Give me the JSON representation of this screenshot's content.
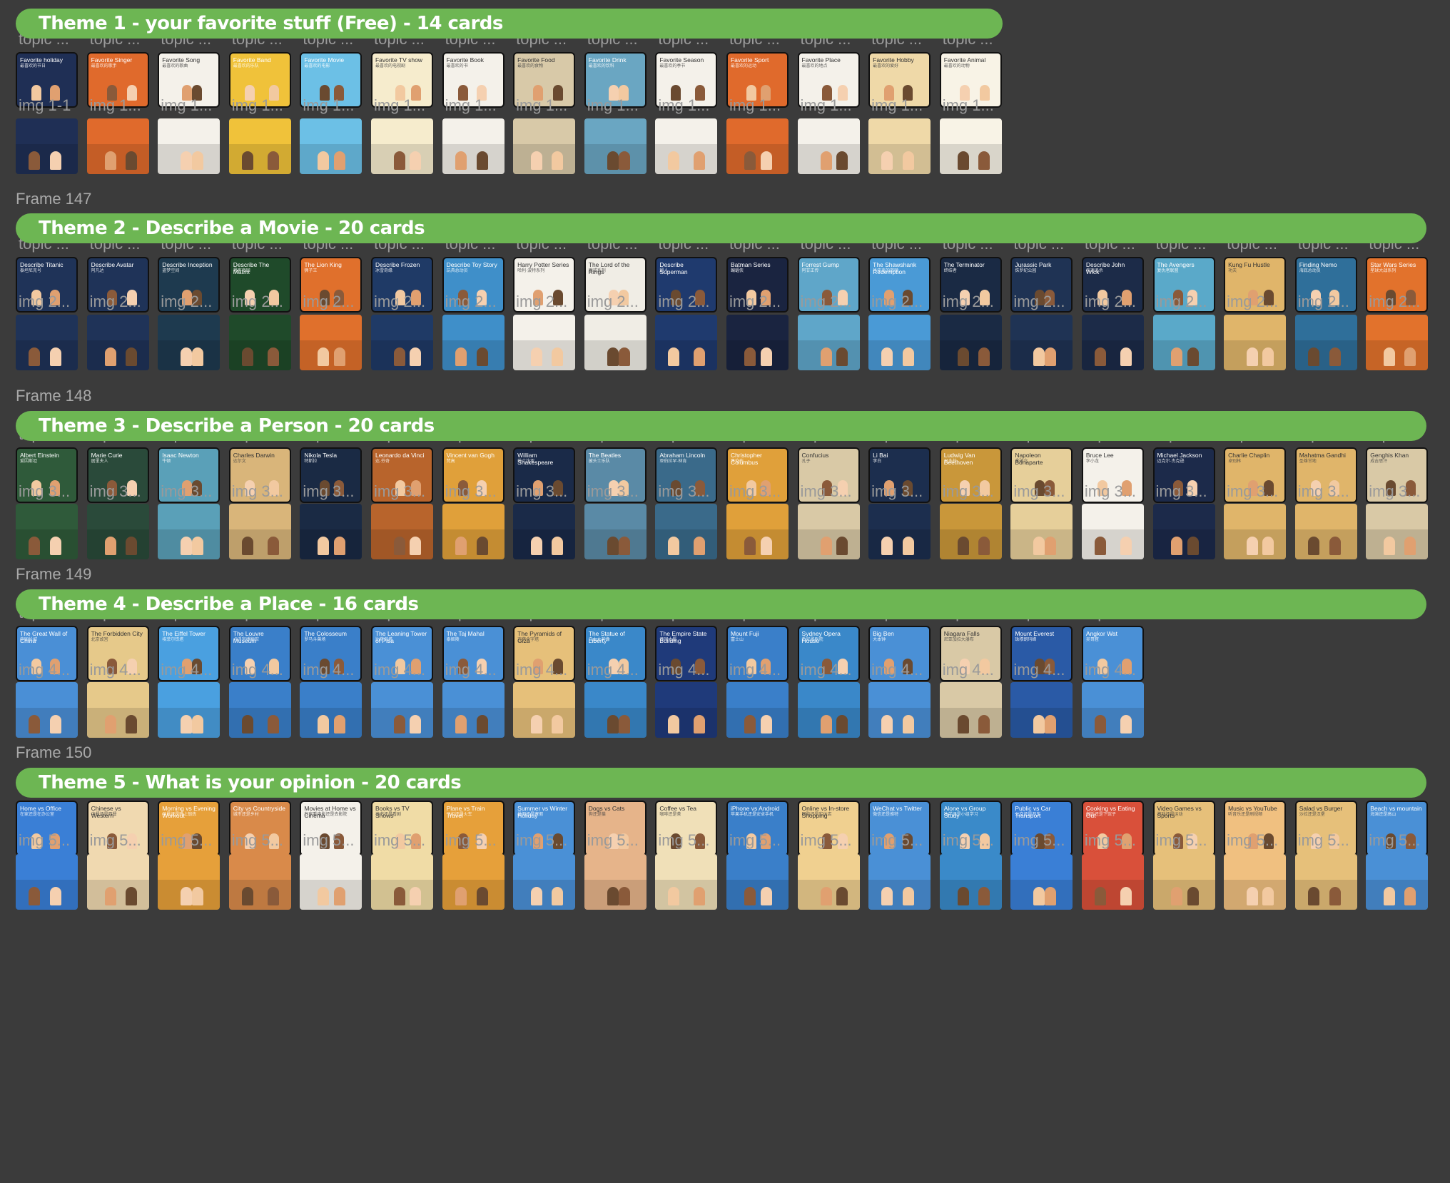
{
  "colors": {
    "banner": "#6db653",
    "background": "#3b3b3b",
    "label": "#9a9a9a"
  },
  "sections": [
    {
      "frame_label": "",
      "banner": "Theme 1 - your favorite stuff (Free) - 14 cards",
      "topic_labels": [
        "topic ...",
        "topic ...",
        "topic ...",
        "topic ...",
        "topic ...",
        "topic ...",
        "topic ...",
        "topic ...",
        "topic ...",
        "topic ...",
        "topic ...",
        "topic ...",
        "topic ...",
        "topic ..."
      ],
      "img_labels": [
        "img 1-1",
        "img 1...",
        "img 1...",
        "img 1...",
        "img 1...",
        "img 1...",
        "img 1...",
        "img 1...",
        "img 1...",
        "img 1...",
        "img 1...",
        "img 1...",
        "img 1...",
        "img 1..."
      ],
      "cards": [
        {
          "title": "Favorite holiday",
          "sub": "最喜欢的节日",
          "bg": "#1f2f55"
        },
        {
          "title": "Favorite Singer",
          "sub": "最喜欢的歌手",
          "bg": "#e06a2c"
        },
        {
          "title": "Favorite Song",
          "sub": "最喜欢的歌曲",
          "bg": "#f4f1ea"
        },
        {
          "title": "Favorite Band",
          "sub": "最喜欢的乐队",
          "bg": "#f0c23a"
        },
        {
          "title": "Favorite Movie",
          "sub": "最喜欢的电影",
          "bg": "#6cc0e6"
        },
        {
          "title": "Favorite TV show",
          "sub": "最喜欢的电视剧",
          "bg": "#f6eccd"
        },
        {
          "title": "Favorite Book",
          "sub": "最喜欢的书",
          "bg": "#f4f1ea"
        },
        {
          "title": "Favorite Food",
          "sub": "最喜欢的食物",
          "bg": "#d8c9a8"
        },
        {
          "title": "Favorite Drink",
          "sub": "最喜欢的饮料",
          "bg": "#6aa6c2"
        },
        {
          "title": "Favorite Season",
          "sub": "最喜欢的季节",
          "bg": "#f4f1ea"
        },
        {
          "title": "Favorite Sport",
          "sub": "最喜欢的运动",
          "bg": "#e06a2c"
        },
        {
          "title": "Favorite Place",
          "sub": "最喜欢的地点",
          "bg": "#f4f1ea"
        },
        {
          "title": "Favorite Hobby",
          "sub": "最喜欢的爱好",
          "bg": "#efd9a8"
        },
        {
          "title": "Favorite Animal",
          "sub": "最喜欢的动物",
          "bg": "#f8f3e6"
        }
      ]
    },
    {
      "frame_label": "Frame 147",
      "banner": "Theme 2 - Describe a Movie - 20 cards",
      "topic_labels": [
        "topic ...",
        "topic ...",
        "topic ...",
        "topic ...",
        "topic ...",
        "topic ...",
        "topic ...",
        "topic ...",
        "topic ...",
        "topic ...",
        "topic ...",
        "topic ...",
        "topic ...",
        "topic ...",
        "topic ...",
        "topic ...",
        "topic ...",
        "topic ...",
        "topic ...",
        "topic ..."
      ],
      "img_labels": [
        "img 2...",
        "img 2...",
        "img 2...",
        "img 2...",
        "img 2...",
        "img 2...",
        "img 2...",
        "img 2...",
        "img 2...",
        "img 2...",
        "img 2...",
        "img 2...",
        "img 2...",
        "img 2...",
        "img 2...",
        "img 2...",
        "img 2...",
        "img 2...",
        "img 2...",
        "img 2..."
      ],
      "cards": [
        {
          "title": "Describe Titanic",
          "sub": "泰坦尼克号",
          "bg": "#1f3358"
        },
        {
          "title": "Describe Avatar",
          "sub": "阿凡达",
          "bg": "#1f3358"
        },
        {
          "title": "Describe Inception",
          "sub": "盗梦空间",
          "bg": "#1e3a4f"
        },
        {
          "title": "Describe The Matrix",
          "sub": "黑客帝国",
          "bg": "#1f4a2a"
        },
        {
          "title": "The Lion King",
          "sub": "狮子王",
          "bg": "#e0702c"
        },
        {
          "title": "Describe Frozen",
          "sub": "冰雪奇缘",
          "bg": "#1f3a66"
        },
        {
          "title": "Describe Toy Story",
          "sub": "玩具总动员",
          "bg": "#3f8fc9"
        },
        {
          "title": "Harry Potter Series",
          "sub": "哈利·波特系列",
          "bg": "#f4f1ea"
        },
        {
          "title": "The Lord of the Rings",
          "sub": "魔戒系列",
          "bg": "#f0ede5"
        },
        {
          "title": "Describe Superman",
          "sub": "超人",
          "bg": "#1f3a6e"
        },
        {
          "title": "Batman Series",
          "sub": "蝙蝠侠",
          "bg": "#1a2440"
        },
        {
          "title": "Forrest Gump",
          "sub": "阿甘正传",
          "bg": "#5fa6c9"
        },
        {
          "title": "The Shawshank Redemption",
          "sub": "肖申克的救赎",
          "bg": "#4a9ad6"
        },
        {
          "title": "The Terminator",
          "sub": "终结者",
          "bg": "#1a2a44"
        },
        {
          "title": "Jurassic Park",
          "sub": "侏罗纪公园",
          "bg": "#1f3354"
        },
        {
          "title": "Describe John Wick",
          "sub": "疾速追杀",
          "bg": "#1c2b48"
        },
        {
          "title": "The Avengers",
          "sub": "复仇者联盟",
          "bg": "#5aa9c9"
        },
        {
          "title": "Kung Fu Hustle",
          "sub": "功夫",
          "bg": "#e0b56a"
        },
        {
          "title": "Finding Nemo",
          "sub": "海底总动员",
          "bg": "#2f6f9a"
        },
        {
          "title": "Star Wars Series",
          "sub": "星球大战系列",
          "bg": "#e2722c"
        }
      ]
    },
    {
      "frame_label": "Frame 148",
      "banner": "Theme 3 - Describe a Person - 20 cards",
      "topic_labels": [
        "topic ...",
        "topic ...",
        "topic ...",
        "topic ...",
        "topic ...",
        "topic ...",
        "topic ...",
        "topic ...",
        "topic ...",
        "topic ...",
        "topic ...",
        "topic ...",
        "topic ...",
        "topic ...",
        "topic ...",
        "topic ...",
        "topic ...",
        "topic ...",
        "topic ...",
        "topic ..."
      ],
      "img_labels": [
        "img 3...",
        "img 3...",
        "img 3...",
        "img 3...",
        "img 3...",
        "img 3...",
        "img 3...",
        "img 3...",
        "img 3...",
        "img 3...",
        "img 3...",
        "img 3...",
        "img 3...",
        "img 3...",
        "img 3...",
        "img 3...",
        "img 3...",
        "img 3...",
        "img 3...",
        "img 3..."
      ],
      "cards": [
        {
          "title": "Albert Einstein",
          "sub": "爱因斯坦",
          "bg": "#2f5a3a"
        },
        {
          "title": "Marie Curie",
          "sub": "居里夫人",
          "bg": "#2a4a3a"
        },
        {
          "title": "Isaac Newton",
          "sub": "牛顿",
          "bg": "#5aa0b8"
        },
        {
          "title": "Charles Darwin",
          "sub": "达尔文",
          "bg": "#d9b57a"
        },
        {
          "title": "Nikola Tesla",
          "sub": "特斯拉",
          "bg": "#1a2a44"
        },
        {
          "title": "Leonardo da Vinci",
          "sub": "达·芬奇",
          "bg": "#b8642c"
        },
        {
          "title": "Vincent van Gogh",
          "sub": "梵高",
          "bg": "#e0a03a"
        },
        {
          "title": "William Shakespeare",
          "sub": "莎士比亚",
          "bg": "#1a2a48"
        },
        {
          "title": "The Beatles",
          "sub": "披头士乐队",
          "bg": "#5a8aa6"
        },
        {
          "title": "Abraham Lincoln",
          "sub": "亚伯拉罕·林肯",
          "bg": "#3a6a8a"
        },
        {
          "title": "Christopher Columbus",
          "sub": "哥伦布",
          "bg": "#e0a03a"
        },
        {
          "title": "Confucius",
          "sub": "孔子",
          "bg": "#d9c9a6"
        },
        {
          "title": "Li Bai",
          "sub": "李白",
          "bg": "#1c2e4e"
        },
        {
          "title": "Ludwig Van Beethoven",
          "sub": "贝多芬",
          "bg": "#c9973a"
        },
        {
          "title": "Napoleon Bonaparte",
          "sub": "拿破仑",
          "bg": "#e6cf9a"
        },
        {
          "title": "Bruce Lee",
          "sub": "李小龙",
          "bg": "#f4f1ea"
        },
        {
          "title": "Michael Jackson",
          "sub": "迈克尔·杰克逊",
          "bg": "#1c2a4a"
        },
        {
          "title": "Charlie Chaplin",
          "sub": "卓别林",
          "bg": "#e0b56a"
        },
        {
          "title": "Mahatma Gandhi",
          "sub": "圣雄甘地",
          "bg": "#e0b56a"
        },
        {
          "title": "Genghis Khan",
          "sub": "成吉思汗",
          "bg": "#d9c9a6"
        }
      ]
    },
    {
      "frame_label": "Frame 149",
      "banner": "Theme 4 - Describe a Place - 16 cards",
      "topic_labels": [
        "topic ...",
        "topic ...",
        "topic ...",
        "topic ...",
        "topic ...",
        "topic ...",
        "topic ...",
        "topic ...",
        "topic ...",
        "topic ...",
        "topic ...",
        "topic ...",
        "topic ...",
        "topic ...",
        "topic ...",
        "topic ..."
      ],
      "img_labels": [
        "img 4...",
        "img 4...",
        "img 4...",
        "img 4...",
        "img 4...",
        "img 4...",
        "img 4...",
        "img 4...",
        "img 4...",
        "img 4...",
        "img 4...",
        "img 4...",
        "img 4...",
        "img 4...",
        "img 4...",
        "img 4..."
      ],
      "cards": [
        {
          "title": "The Great Wall of China",
          "sub": "中国长城",
          "bg": "#4a8fd6"
        },
        {
          "title": "The Forbidden City",
          "sub": "北京故宫",
          "bg": "#e6c98a"
        },
        {
          "title": "The Eiffel Tower",
          "sub": "埃菲尔铁塔",
          "bg": "#4aa0e0"
        },
        {
          "title": "The Louvre Museum",
          "sub": "卢浮宫博物馆",
          "bg": "#3a7fc9"
        },
        {
          "title": "The Colosseum",
          "sub": "罗马斗兽场",
          "bg": "#3a7fc9"
        },
        {
          "title": "The Leaning Tower of Pisa",
          "sub": "比萨斜塔",
          "bg": "#4a90d6"
        },
        {
          "title": "The Taj Mahal",
          "sub": "泰姬陵",
          "bg": "#4a90d6"
        },
        {
          "title": "The Pyramids of Giza",
          "sub": "吉萨金字塔",
          "bg": "#e6c07a"
        },
        {
          "title": "The Statue of Liberty",
          "sub": "自由女神像",
          "bg": "#3a88c9"
        },
        {
          "title": "The Empire State Building",
          "sub": "帝国大厦",
          "bg": "#1f3a7a"
        },
        {
          "title": "Mount Fuji",
          "sub": "富士山",
          "bg": "#3a7fc9"
        },
        {
          "title": "Sydney Opera House",
          "sub": "悉尼歌剧院",
          "bg": "#3a88c9"
        },
        {
          "title": "Big Ben",
          "sub": "大本钟",
          "bg": "#4a90d6"
        },
        {
          "title": "Niagara Falls",
          "sub": "尼亚加拉大瀑布",
          "bg": "#d9c9a6"
        },
        {
          "title": "Mount Everest",
          "sub": "珠穆朗玛峰",
          "bg": "#2a5aa6"
        },
        {
          "title": "Angkor Wat",
          "sub": "吴哥窟",
          "bg": "#4a90d6"
        }
      ]
    },
    {
      "frame_label": "Frame 150",
      "banner": "Theme 5 - What is your opinion - 20 cards",
      "topic_labels": [
        "topic ...",
        "topic ...",
        "topic ...",
        "topic ...",
        "topic ...",
        "topic ...",
        "topic ...",
        "topic ...",
        "topic ...",
        "topic ...",
        "topic ...",
        "topic ...",
        "topic ...",
        "topic ...",
        "topic ...",
        "topic ...",
        "topic ...",
        "topic ...",
        "topic ...",
        "topic ..."
      ],
      "img_labels": [
        "img 5...",
        "img 5...",
        "img 5...",
        "img 5...",
        "img 5...",
        "img 5...",
        "img 5...",
        "img 5...",
        "img 5...",
        "img 5...",
        "img 5...",
        "img 5...",
        "img 5...",
        "img 5...",
        "img 5...",
        "img 5...",
        "img 5...",
        "img 5...",
        "img 5...",
        "img 5..."
      ],
      "cards": [
        {
          "title": "Home vs Office",
          "sub": "在家还是在办公室",
          "bg": "#3a7fd6"
        },
        {
          "title": "Chinese vs Western",
          "sub": "中餐还是西餐",
          "bg": "#f0d9b0"
        },
        {
          "title": "Morning vs Evening Workout",
          "sub": "早晨还是晚上锻炼",
          "bg": "#e6a03a"
        },
        {
          "title": "City vs Countryside",
          "sub": "城市还是乡村",
          "bg": "#d98a4a"
        },
        {
          "title": "Movies at Home vs Cinema",
          "sub": "在家看电影还是去影院",
          "bg": "#f4f1ea"
        },
        {
          "title": "Books vs TV Shows",
          "sub": "读书还是看剧",
          "bg": "#f0dca6"
        },
        {
          "title": "Plane vs Train Travel",
          "sub": "飞机还是火车",
          "bg": "#e6a03a"
        },
        {
          "title": "Summer vs Winter Holiday",
          "sub": "暑假还是寒假",
          "bg": "#4a90d6"
        },
        {
          "title": "Dogs vs Cats",
          "sub": "狗还是猫",
          "bg": "#e6b48a"
        },
        {
          "title": "Coffee vs Tea",
          "sub": "咖啡还是茶",
          "bg": "#f0e0b8"
        },
        {
          "title": "iPhone vs Android",
          "sub": "苹果手机还是安卓手机",
          "bg": "#3a7fc9"
        },
        {
          "title": "Online vs In-store Shopping",
          "sub": "网购还是实体店",
          "bg": "#f0d090"
        },
        {
          "title": "WeChat vs Twitter",
          "sub": "微信还是推特",
          "bg": "#4a90d6"
        },
        {
          "title": "Alone vs Group Study",
          "sub": "独学还是小组学习",
          "bg": "#3a8ac9"
        },
        {
          "title": "Public vs Car Transport",
          "sub": "公交还是开车",
          "bg": "#3a7fd6"
        },
        {
          "title": "Cooking vs Eating Out",
          "sub": "做饭还是下馆子",
          "bg": "#d9503a"
        },
        {
          "title": "Video Games vs Sports",
          "sub": "游戏还是运动",
          "bg": "#e6c07a"
        },
        {
          "title": "Music vs YouTube",
          "sub": "听音乐还是刷视频",
          "bg": "#f0c080"
        },
        {
          "title": "Salad vs Burger",
          "sub": "沙拉还是汉堡",
          "bg": "#e6c07a"
        },
        {
          "title": "Beach vs mountain",
          "sub": "海滩还是高山",
          "bg": "#4a90d6"
        }
      ]
    }
  ]
}
